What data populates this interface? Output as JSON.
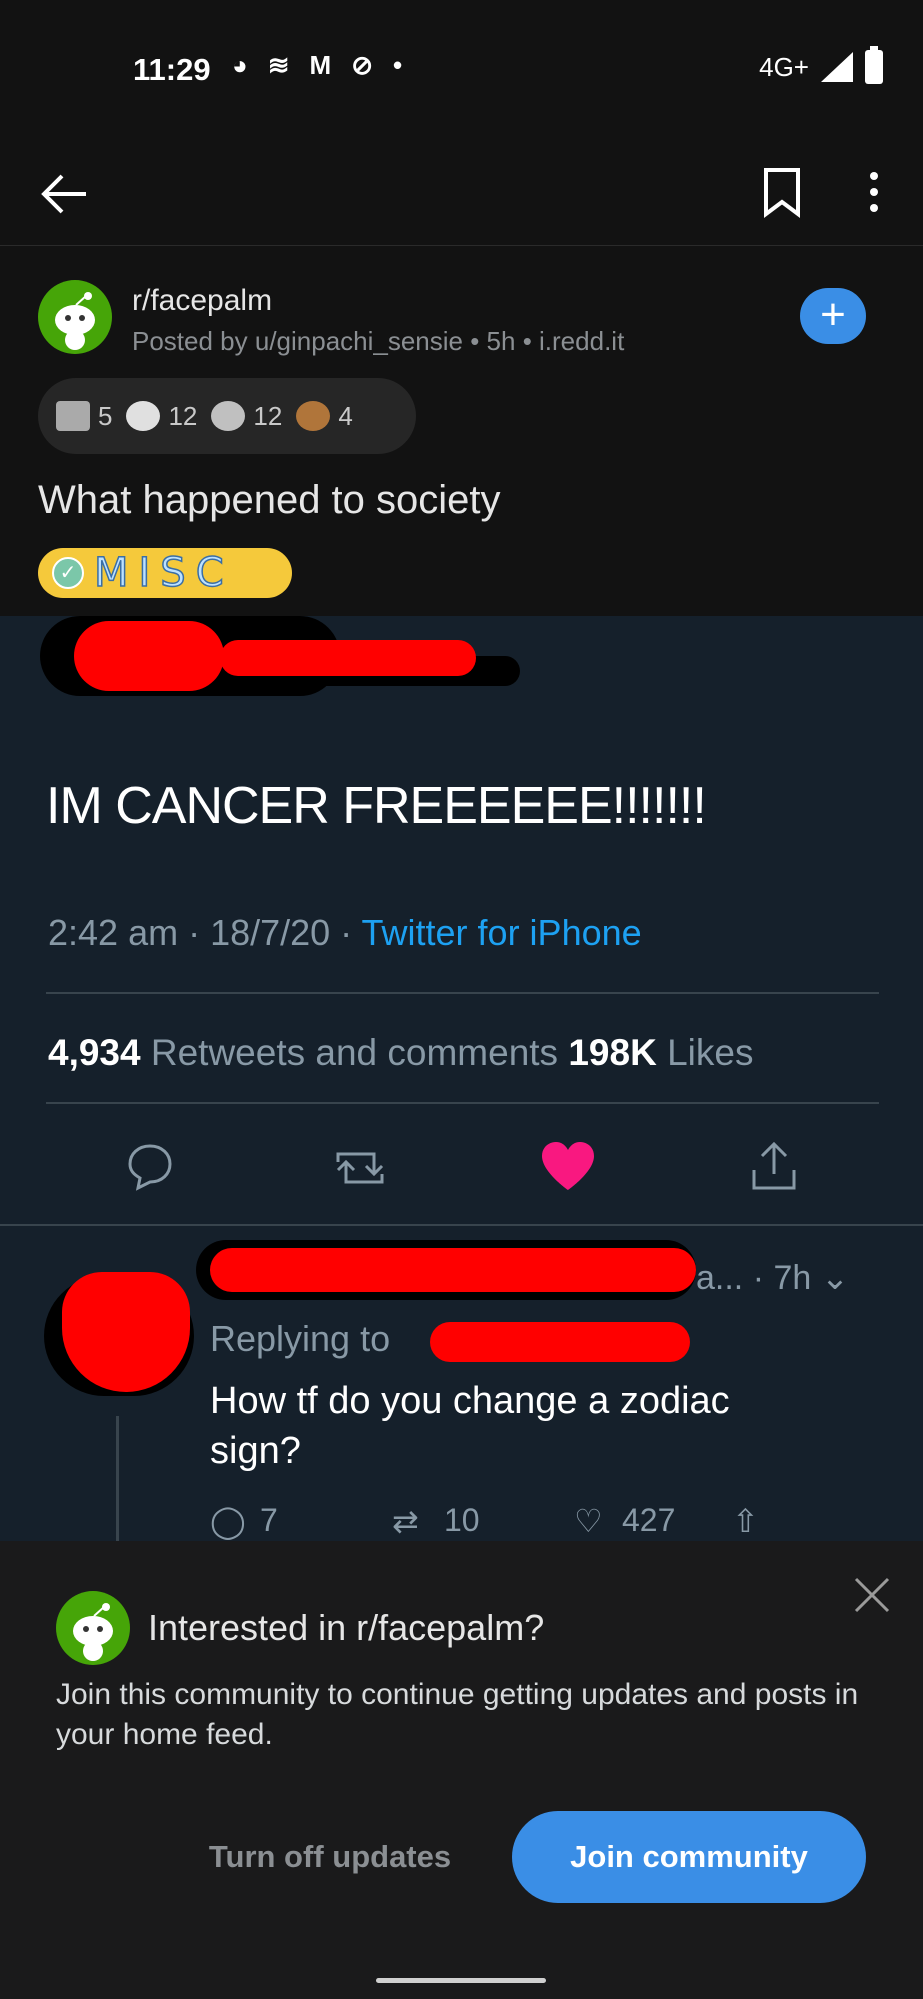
{
  "status_bar": {
    "time": "11:29",
    "network": "4G+"
  },
  "app_bar": {
    "back_icon": "arrow-left-icon",
    "bookmark_icon": "bookmark-icon",
    "more_icon": "more-vertical-icon"
  },
  "post": {
    "subreddit": "r/facepalm",
    "meta": "Posted by u/ginpachi_sensie • 5h • i.redd.it",
    "join_label": "+",
    "awards": [
      {
        "icon": "award-hands-icon",
        "count": "5"
      },
      {
        "icon": "award-face-icon",
        "count": "12"
      },
      {
        "icon": "award-silver-icon",
        "count": "12"
      },
      {
        "icon": "award-animal-icon",
        "count": "4"
      }
    ],
    "title": "What happened to society",
    "flair": "MISC"
  },
  "tweet": {
    "text": "IM CANCER FREEEEEE!!!!!!!",
    "time": "2:42 am · 18/7/20 · ",
    "source": "Twitter for iPhone",
    "retweets_count": "4,934",
    "retweets_label": " Retweets and comments ",
    "likes_count": "198K",
    "likes_label": " Likes",
    "reply": {
      "meta": "a... · 7h",
      "replying_to": "Replying to",
      "text": "How tf do you change a zodiac sign?",
      "replies": "7",
      "retweets": "10",
      "likes": "427"
    }
  },
  "sheet": {
    "title": "Interested in r/facepalm?",
    "body": "Join this community to continue getting updates and posts in your home feed.",
    "turn_off": "Turn off updates",
    "join": "Join community"
  },
  "colors": {
    "accent": "#3a8ee6",
    "twitter_blue": "#1da1f2",
    "like_red": "#f91880",
    "flair": "#f5c93b"
  }
}
